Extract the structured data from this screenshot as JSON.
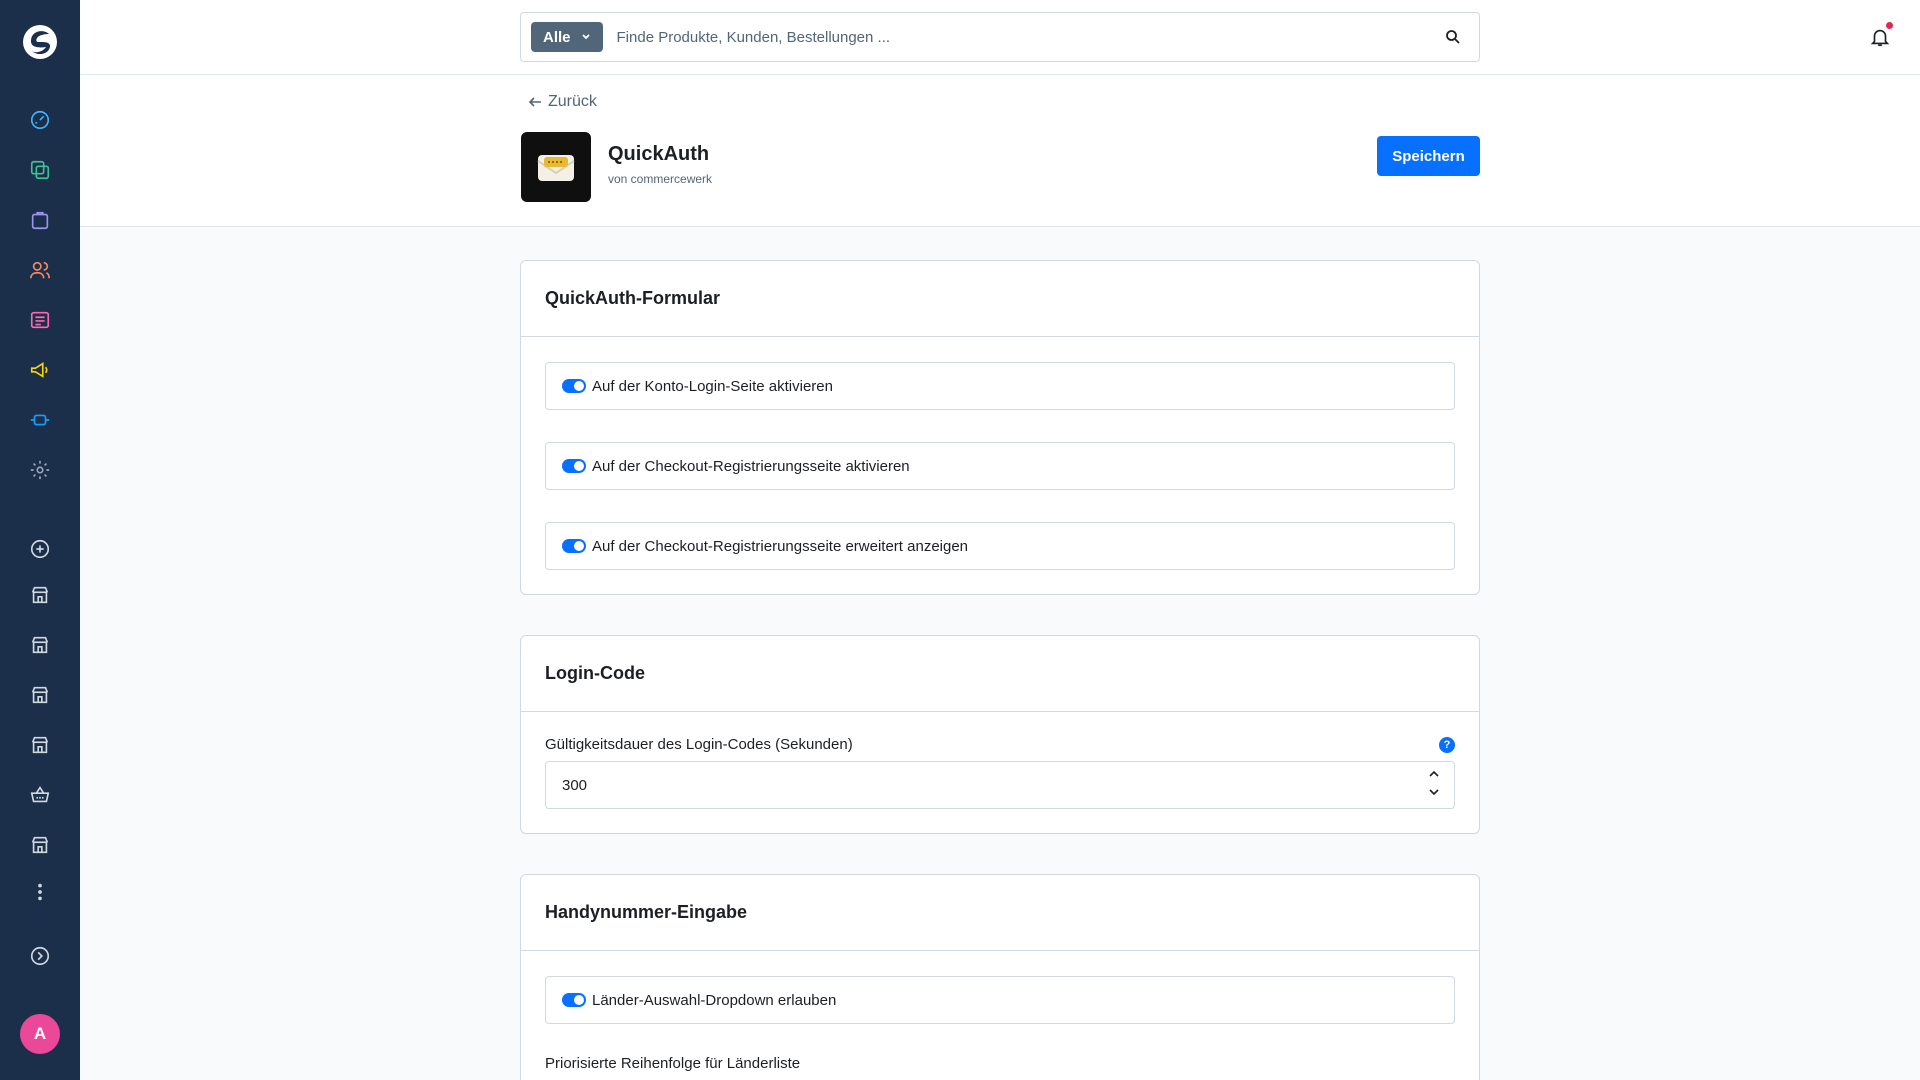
{
  "search": {
    "type_label": "Alle",
    "placeholder": "Finde Produkte, Kunden, Bestellungen ..."
  },
  "page": {
    "back_label": "Zurück",
    "app_title": "QuickAuth",
    "app_author": "von commercewerk",
    "save_label": "Speichern"
  },
  "sections": {
    "form": {
      "title": "QuickAuth-Formular",
      "switches": [
        {
          "label": "Auf der Konto-Login-Seite aktivieren",
          "enabled": true
        },
        {
          "label": "Auf der Checkout-Registrierungsseite aktivieren",
          "enabled": true
        },
        {
          "label": "Auf der Checkout-Registrierungsseite erweitert anzeigen",
          "enabled": true
        }
      ]
    },
    "login_code": {
      "title": "Login-Code",
      "field_label": "Gültigkeitsdauer des Login-Codes (Sekunden)",
      "help_badge": "?",
      "field_value": "300"
    },
    "phone": {
      "title": "Handynummer-Eingabe",
      "switches": [
        {
          "label": "Länder-Auswahl-Dropdown erlauben",
          "enabled": true
        }
      ],
      "field_label": "Priorisierte Reihenfolge für Länderliste"
    }
  },
  "user": {
    "avatar_initial": "A"
  },
  "colors": {
    "sidebar": "#1b2e4a",
    "primary": "#0870ff",
    "avatar": "#ec4899",
    "notification_dot": "#de294c"
  },
  "icons": {
    "nav": [
      "dashboard-icon",
      "catalog-icon",
      "orders-icon",
      "customers-icon",
      "content-icon",
      "marketing-icon",
      "extensions-icon",
      "settings-icon",
      "add-sales-channel-icon",
      "storefront-icon",
      "storefront-icon",
      "storefront-icon",
      "storefront-icon",
      "basket-icon",
      "storefront-icon",
      "more-icon",
      "expand-icon"
    ]
  }
}
